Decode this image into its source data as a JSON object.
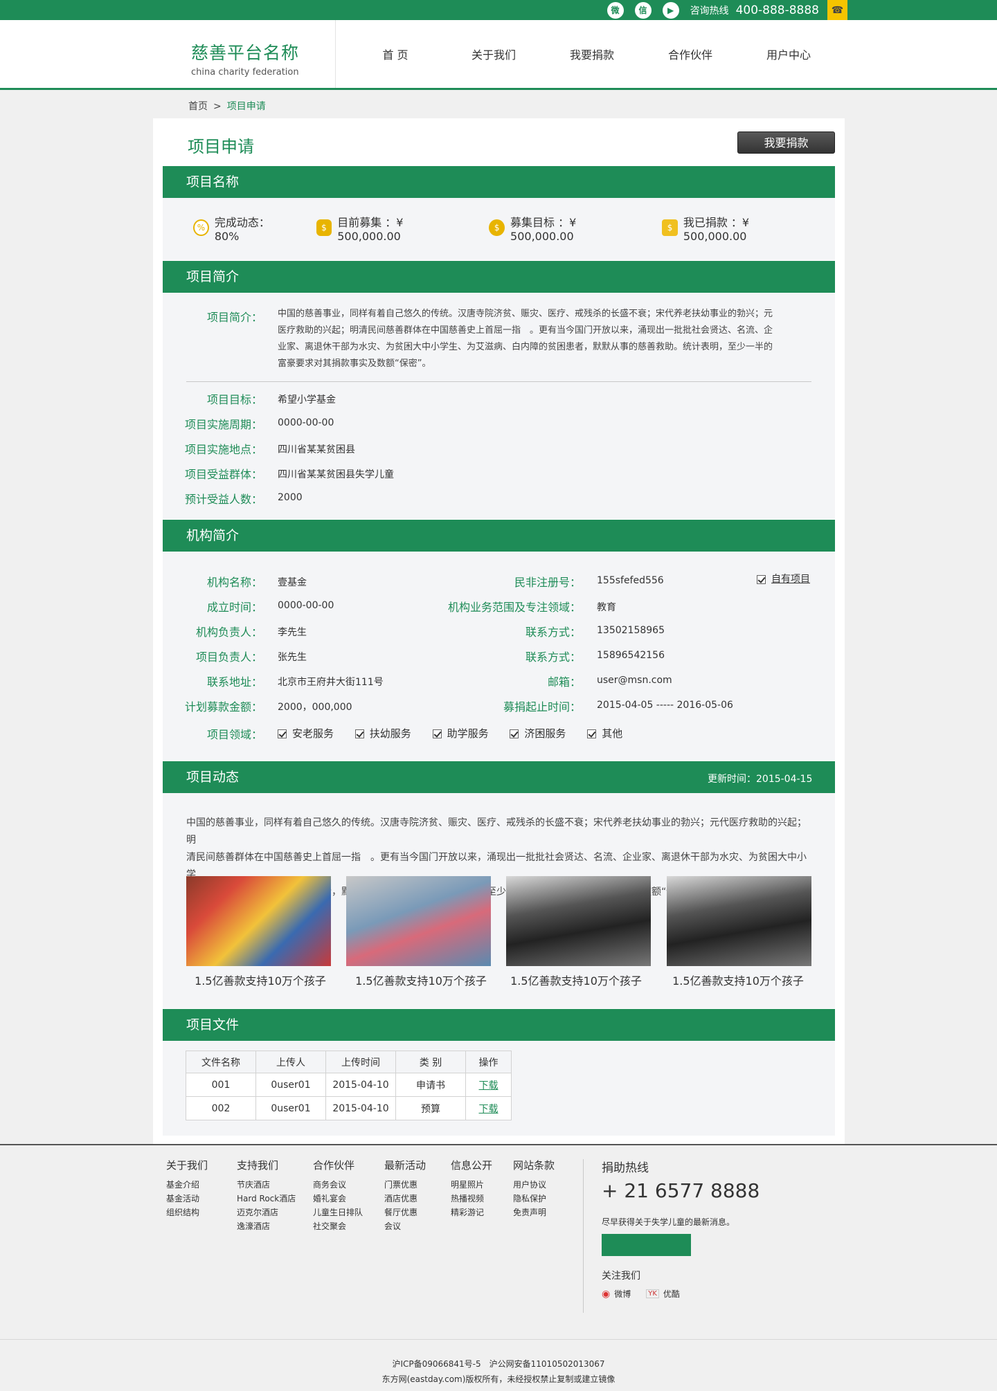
{
  "topbar": {
    "hotline_label": "咨询热线",
    "hotline_number": "400-888-8888"
  },
  "logo": {
    "name": "慈善平台名称",
    "sub": "china charity federation"
  },
  "nav": [
    "首 页",
    "关于我们",
    "我要捐款",
    "合作伙伴",
    "用户中心"
  ],
  "breadcrumb": {
    "home": "首页",
    "sep": ">",
    "current": "项目申请"
  },
  "page": {
    "title": "项目申请",
    "donate_button": "我要捐款"
  },
  "project_name": {
    "heading": "项目名称",
    "stats": [
      {
        "icon": "percent-icon",
        "label": "完成动态：80%"
      },
      {
        "icon": "money-bag-icon",
        "label": "目前募集 ：¥ 500,000.00"
      },
      {
        "icon": "coin-bag-icon",
        "label": "募集目标 ：¥ 500,000.00"
      },
      {
        "icon": "hand-coin-icon",
        "label": "我已捐款 ：¥ 500,000.00"
      }
    ]
  },
  "intro": {
    "heading": "项目简介",
    "intro_label": "项目简介：",
    "intro_lines": [
      "中国的慈善事业，同样有着自己悠久的传统。汉唐寺院济贫、赈灾、医疗、戒残杀的长盛不衰；宋代养老扶幼事业的勃兴；元",
      "医疗救助的兴起；明清民间慈善群体在中国慈善史上首屈一指　。更有当今国门开放以来，涌现出一批批社会贤达、名流、企",
      "业家、离退休干部为水灾、为贫困大中小学生、为艾滋病、白内障的贫困患者，默默从事的慈善救助。统计表明，至少一半的",
      "富豪要求对其捐款事实及数额“保密”。"
    ],
    "fields": [
      {
        "label": "项目目标：",
        "value": "希望小学基金"
      },
      {
        "label": "项目实施周期：",
        "value": "0000-00-00"
      },
      {
        "label": "项目实施地点：",
        "value": "四川省某某贫困县"
      },
      {
        "label": "项目受益群体：",
        "value": "四川省某某贫困县失学儿童"
      },
      {
        "label": "预计受益人数：",
        "value": "2000"
      }
    ]
  },
  "org": {
    "heading": "机构简介",
    "own_project": "自有项目",
    "left": [
      {
        "label": "机构名称：",
        "value": "壹基金"
      },
      {
        "label": "成立时间：",
        "value": "0000-00-00"
      },
      {
        "label": "机构负责人：",
        "value": "李先生"
      },
      {
        "label": "项目负责人：",
        "value": "张先生"
      },
      {
        "label": "联系地址：",
        "value": "北京市王府井大街111号"
      },
      {
        "label": "计划募款金额：",
        "value": "2000，000,000"
      }
    ],
    "right": [
      {
        "label": "民非注册号：",
        "value": "155sfefed556"
      },
      {
        "label": "机构业务范围及专注领域：",
        "value": "教育"
      },
      {
        "label": "联系方式：",
        "value": "13502158965"
      },
      {
        "label": "联系方式：",
        "value": "15896542156"
      },
      {
        "label": "邮箱：",
        "value": "user@msn.com"
      },
      {
        "label": "募捐起止时间：",
        "value": "2015-04-05 ----- 2016-05-06"
      }
    ],
    "domain_label": "项目领域：",
    "domains": [
      "安老服务",
      "扶幼服务",
      "助学服务",
      "济困服务",
      "其他"
    ]
  },
  "news": {
    "heading": "项目动态",
    "update": "更新时间：2015-04-15",
    "lines": [
      "中国的慈善事业，同样有着自己悠久的传统。汉唐寺院济贫、赈灾、医疗、戒残杀的长盛不衰；宋代养老扶幼事业的勃兴；元代医疗救助的兴起；明",
      "清民间慈善群体在中国慈善史上首屈一指　。更有当今国门开放以来，涌现出一批批社会贤达、名流、企业家、离退休干部为水灾、为贫困大中小学",
      "生、为艾滋病、白内障的贫困患者，默默从事的慈善救助。统计表明，至少一半的富豪要求对其捐款事实及数额“保密”。"
    ],
    "captions": [
      "1.5亿善款支持10万个孩子",
      "1.5亿善款支持10万个孩子",
      "1.5亿善款支持10万个孩子",
      "1.5亿善款支持10万个孩子"
    ]
  },
  "files": {
    "heading": "项目文件",
    "columns": [
      "文件名称",
      "上传人",
      "上传时间",
      "类 别",
      "操作"
    ],
    "rows": [
      [
        "001",
        "0user01",
        "2015-04-10",
        "申请书",
        "下载"
      ],
      [
        "002",
        "0user01",
        "2015-04-10",
        "预算",
        "下载"
      ]
    ]
  },
  "footer": {
    "cols": [
      {
        "h": "关于我们",
        "items": [
          "基金介绍",
          "基金活动",
          "组织结构"
        ]
      },
      {
        "h": "支持我们",
        "items": [
          "节庆酒店",
          "Hard Rock酒店",
          "迈克尔酒店",
          "逸濠酒店"
        ]
      },
      {
        "h": "合作伙伴",
        "items": [
          "商务会议",
          "婚礼宴会",
          "儿童生日排队",
          "社交聚会"
        ]
      },
      {
        "h": "最新活动",
        "items": [
          "门票优惠",
          "酒店优惠",
          "餐厅优惠",
          "会议"
        ]
      },
      {
        "h": "信息公开",
        "items": [
          "明星照片",
          "热播视频",
          "精彩游记"
        ]
      },
      {
        "h": "网站条款",
        "items": [
          "用户协议",
          "隐私保护",
          "免责声明"
        ]
      }
    ],
    "hotline_title": "捐助热线",
    "hotline": "+ 21 6577 8888",
    "subscribe_text": "尽早获得关于失学儿童的最新消息。",
    "follow": "关注我们",
    "weibo": "微博",
    "youku": "优酷",
    "icp": "沪ICP备09066841号-5　沪公网安备11010502013067",
    "copyright": "东方网(eastday.com)版权所有，未经授权禁止复制或建立镜像"
  },
  "colors": {
    "brand": "#1e8c57",
    "accent": "#f5c400"
  }
}
